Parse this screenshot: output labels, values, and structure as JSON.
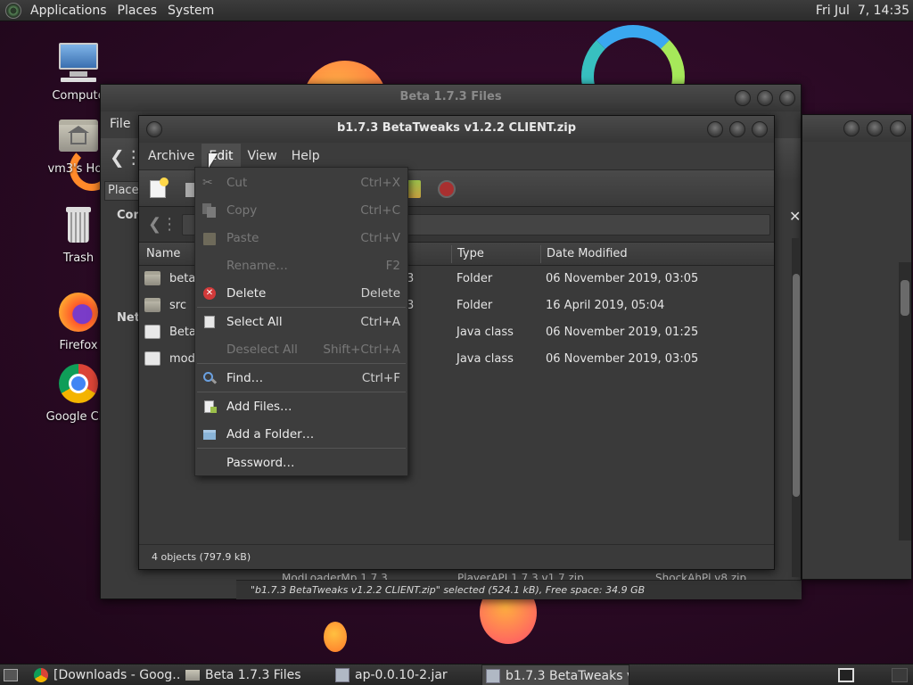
{
  "top_panel": {
    "menus": [
      "Applications",
      "Places",
      "System"
    ],
    "clock": "Fri Jul  7, 14:35"
  },
  "desktop_icons": [
    {
      "label": "Compute",
      "icon": "computer-icon"
    },
    {
      "label": "vm3's Hon",
      "icon": "home-folder-icon"
    },
    {
      "label": "Trash",
      "icon": "trash-icon"
    },
    {
      "label": "Firefox",
      "icon": "firefox-icon"
    },
    {
      "label": "Google Chr",
      "icon": "chrome-icon"
    }
  ],
  "files_window": {
    "title": "Beta 1.7.3 Files",
    "menu_file": "File",
    "places_label": "Places",
    "sidebar_computer": "Con",
    "sidebar_network": "Netv",
    "bottom_names": [
      "ModLoaderMp 1.7.3",
      "PlayerAPI 1.7.3 v1.7.zip",
      "ShockAhPl v8.zip"
    ],
    "status": "\"b1.7.3 BetaTweaks v1.2.2 CLIENT.zip\" selected (524.1 kB), Free space: 34.9 GB"
  },
  "archive_window": {
    "title": "b1.7.3 BetaTweaks v1.2.2 CLIENT.zip",
    "menus": [
      "Archive",
      "Edit",
      "View",
      "Help"
    ],
    "columns": {
      "name": "Name",
      "type": "Type",
      "date": "Date Modified"
    },
    "rows": [
      {
        "name": "betat",
        "size": "3",
        "type": "Folder",
        "date": "06 November 2019, 03:05",
        "icon": "folder-icon"
      },
      {
        "name": "src",
        "size": "3",
        "type": "Folder",
        "date": "16 April 2019, 05:04",
        "icon": "folder-icon"
      },
      {
        "name": "BetaT",
        "size": "",
        "type": "Java class",
        "date": "06 November 2019, 01:25",
        "icon": "java-class-icon"
      },
      {
        "name": "mod_",
        "size": "",
        "type": "Java class",
        "date": "06 November 2019, 03:05",
        "icon": "java-class-icon"
      }
    ],
    "status": "4 objects (797.9 kB)"
  },
  "edit_menu": {
    "items": [
      {
        "label": "Cut",
        "accel": "Ctrl+X",
        "disabled": true,
        "icon": "cut-icon"
      },
      {
        "label": "Copy",
        "accel": "Ctrl+C",
        "disabled": true,
        "icon": "copy-icon"
      },
      {
        "label": "Paste",
        "accel": "Ctrl+V",
        "disabled": true,
        "icon": "paste-icon"
      },
      {
        "label": "Rename…",
        "accel": "F2",
        "disabled": true,
        "icon": ""
      },
      {
        "label": "Delete",
        "accel": "Delete",
        "disabled": false,
        "icon": "delete-icon"
      },
      {
        "label": "Select All",
        "accel": "Ctrl+A",
        "disabled": false,
        "icon": "select-all-icon"
      },
      {
        "label": "Deselect All",
        "accel": "Shift+Ctrl+A",
        "disabled": true,
        "icon": ""
      },
      {
        "label": "Find…",
        "accel": "Ctrl+F",
        "disabled": false,
        "icon": "find-icon"
      },
      {
        "label": "Add Files…",
        "accel": "",
        "disabled": false,
        "icon": "add-files-icon"
      },
      {
        "label": "Add a Folder…",
        "accel": "",
        "disabled": false,
        "icon": "add-folder-icon"
      },
      {
        "label": "Password…",
        "accel": "",
        "disabled": false,
        "icon": ""
      }
    ]
  },
  "taskbar": {
    "tasks": [
      {
        "label": "[Downloads - Goog…",
        "icon": "chrome-icon",
        "active": false
      },
      {
        "label": "Beta 1.7.3 Files",
        "icon": "folder-icon",
        "active": false
      },
      {
        "label": "ap-0.0.10-2.jar",
        "icon": "archive-icon",
        "active": false
      },
      {
        "label": "b1.7.3 BetaTweaks v…",
        "icon": "archive-icon",
        "active": true
      }
    ]
  },
  "colors": {
    "accent_menu_bg": "#3d3d3d",
    "delete_red": "#d23a3a",
    "wallpaper_orange": "#ff7a3c",
    "wallpaper_green": "#8fe05a"
  }
}
